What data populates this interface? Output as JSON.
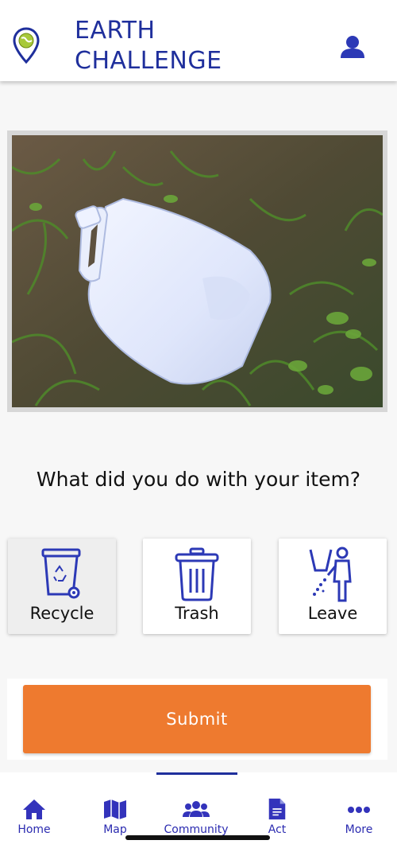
{
  "header": {
    "title_line1": "EARTH",
    "title_line2": "CHALLENGE",
    "logo_icon": "map-pin-globe-icon",
    "profile_icon": "user-icon"
  },
  "photo": {
    "description_icon": "plastic-jug-photo"
  },
  "question": "What did you do with your item?",
  "choices": [
    {
      "label": "Recycle",
      "icon": "recycle-bin-icon",
      "selected": true
    },
    {
      "label": "Trash",
      "icon": "trash-can-icon",
      "selected": false
    },
    {
      "label": "Leave",
      "icon": "litter-person-icon",
      "selected": false
    }
  ],
  "submit": {
    "label": "Submit",
    "color": "#ee7a2f"
  },
  "tabs": [
    {
      "label": "Home",
      "icon": "home-icon"
    },
    {
      "label": "Map",
      "icon": "map-icon"
    },
    {
      "label": "Community",
      "icon": "community-icon"
    },
    {
      "label": "Act",
      "icon": "document-icon"
    },
    {
      "label": "More",
      "icon": "more-icon"
    }
  ],
  "colors": {
    "brand": "#1f2f9c",
    "tab": "#3333bb"
  }
}
